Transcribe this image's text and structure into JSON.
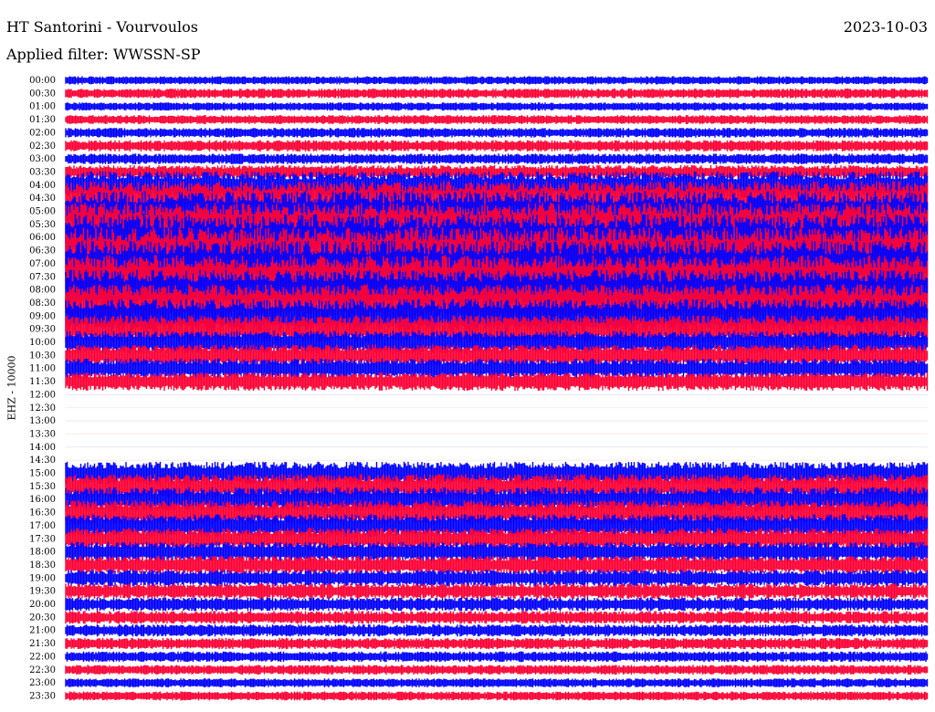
{
  "header": {
    "title": "HT Santorini - Vourvoulos",
    "date": "2023-10-03",
    "filter": "Applied filter: WWSSN-SP"
  },
  "chart_data": {
    "type": "line",
    "title": "HT Santorini - Vourvoulos",
    "ylabel": "EHZ - 10000",
    "xlabel": "",
    "row_labels": [
      "00:00",
      "00:30",
      "01:00",
      "01:30",
      "02:00",
      "02:30",
      "03:00",
      "03:30",
      "04:00",
      "04:30",
      "05:00",
      "05:30",
      "06:00",
      "06:30",
      "07:00",
      "07:30",
      "08:00",
      "08:30",
      "09:00",
      "09:30",
      "10:00",
      "10:30",
      "11:00",
      "11:30",
      "12:00",
      "12:30",
      "13:00",
      "13:30",
      "14:00",
      "14:30",
      "15:00",
      "15:30",
      "16:00",
      "16:30",
      "17:00",
      "17:30",
      "18:00",
      "18:30",
      "19:00",
      "19:30",
      "20:00",
      "20:30",
      "21:00",
      "21:30",
      "22:00",
      "22:30",
      "23:00",
      "23:30"
    ],
    "trace_colors": [
      "#0000ff",
      "#ff0033"
    ],
    "row_amplitude": [
      0.35,
      0.45,
      0.35,
      0.4,
      0.45,
      0.55,
      0.5,
      0.7,
      1.6,
      2.0,
      2.4,
      2.6,
      2.8,
      2.8,
      2.8,
      2.6,
      2.4,
      2.2,
      2.0,
      1.6,
      1.3,
      1.2,
      1.1,
      1.0,
      0.0,
      0.0,
      0.0,
      0.0,
      0.0,
      0.0,
      1.3,
      1.4,
      1.4,
      1.4,
      1.3,
      1.2,
      1.1,
      1.0,
      0.9,
      0.8,
      0.7,
      0.65,
      0.6,
      0.55,
      0.5,
      0.45,
      0.4,
      0.4
    ],
    "row_density": [
      1,
      1,
      1,
      1,
      1,
      1,
      1,
      1,
      1,
      1,
      1,
      1,
      1,
      1,
      1,
      1,
      1,
      1,
      1,
      1,
      1,
      1,
      1,
      1,
      0,
      0,
      0,
      0,
      0,
      0,
      1,
      1,
      1,
      1,
      1,
      1,
      1,
      1,
      1,
      1,
      1,
      1,
      1,
      1,
      1,
      1,
      1,
      1
    ],
    "grid": false,
    "legend": "none"
  }
}
